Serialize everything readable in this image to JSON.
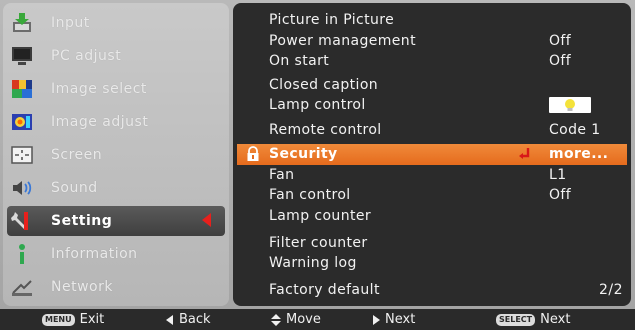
{
  "sidebar": {
    "items": [
      {
        "label": "Input",
        "icon": "input-icon"
      },
      {
        "label": "PC adjust",
        "icon": "pc-adjust-icon"
      },
      {
        "label": "Image select",
        "icon": "image-select-icon"
      },
      {
        "label": "Image adjust",
        "icon": "image-adjust-icon"
      },
      {
        "label": "Screen",
        "icon": "screen-icon"
      },
      {
        "label": "Sound",
        "icon": "sound-icon"
      },
      {
        "label": "Setting",
        "icon": "setting-icon",
        "active": true
      },
      {
        "label": "Information",
        "icon": "information-icon"
      },
      {
        "label": "Network",
        "icon": "network-icon"
      }
    ]
  },
  "settings": {
    "rows": [
      {
        "label": "Picture in Picture",
        "value": ""
      },
      {
        "label": "Power management",
        "value": "Off"
      },
      {
        "label": "On start",
        "value": "Off"
      },
      {
        "label": "Closed caption",
        "value": ""
      },
      {
        "label": "Lamp control",
        "value": "",
        "icon": "lamp-icon"
      },
      {
        "label": "Remote control",
        "value": "Code 1"
      },
      {
        "label": "Security",
        "value": "more...",
        "selected": true
      },
      {
        "label": "Fan",
        "value": "L1"
      },
      {
        "label": "Fan control",
        "value": "Off"
      },
      {
        "label": "Lamp counter",
        "value": ""
      },
      {
        "label": "Filter counter",
        "value": ""
      },
      {
        "label": "Warning log",
        "value": ""
      },
      {
        "label": "Factory default",
        "value": ""
      }
    ],
    "page": "2/2"
  },
  "footer": {
    "menu_key": "MENU",
    "exit_label": "Exit",
    "back_label": "Back",
    "move_label": "Move",
    "next_label": "Next",
    "select_key": "SELECT",
    "select_next_label": "Next"
  },
  "colors": {
    "highlight": "#e56b1d",
    "active_arrow": "#e8201c",
    "panel_dark": "#2b2b2b"
  }
}
